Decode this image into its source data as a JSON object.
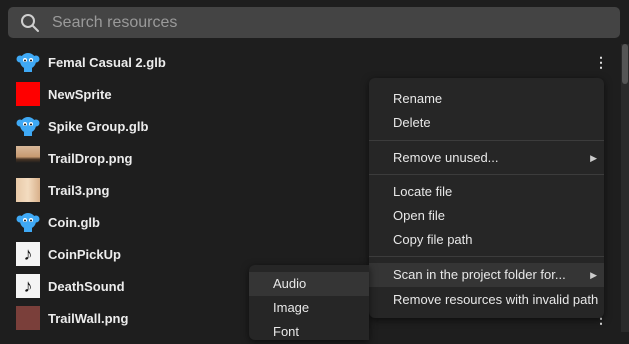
{
  "search": {
    "placeholder": "Search resources",
    "icon": "search-icon"
  },
  "resources": [
    {
      "name": "Femal Casual 2.glb",
      "thumb": "model-icon"
    },
    {
      "name": "NewSprite",
      "thumb": "red-swatch"
    },
    {
      "name": "Spike Group.glb",
      "thumb": "model-icon"
    },
    {
      "name": "TrailDrop.png",
      "thumb": "texture"
    },
    {
      "name": "Trail3.png",
      "thumb": "texture"
    },
    {
      "name": "Coin.glb",
      "thumb": "model-icon"
    },
    {
      "name": "CoinPickUp",
      "thumb": "audio-icon"
    },
    {
      "name": "DeathSound",
      "thumb": "audio-icon"
    },
    {
      "name": "TrailWall.png",
      "thumb": "texture"
    }
  ],
  "row_menu_glyph": "⋮",
  "context_menu": {
    "rename": "Rename",
    "delete": "Delete",
    "remove_unused": "Remove unused...",
    "locate_file": "Locate file",
    "open_file": "Open file",
    "copy_path": "Copy file path",
    "scan_folder": "Scan in the project folder for...",
    "remove_invalid": "Remove resources with invalid path"
  },
  "submenu": {
    "audio": "Audio",
    "image": "Image",
    "font": "Font"
  },
  "colors": {
    "model_icon": "#3fa9f5",
    "sprite_red": "#ff0000",
    "menu_bg": "#262626",
    "highlight": "#353535"
  }
}
